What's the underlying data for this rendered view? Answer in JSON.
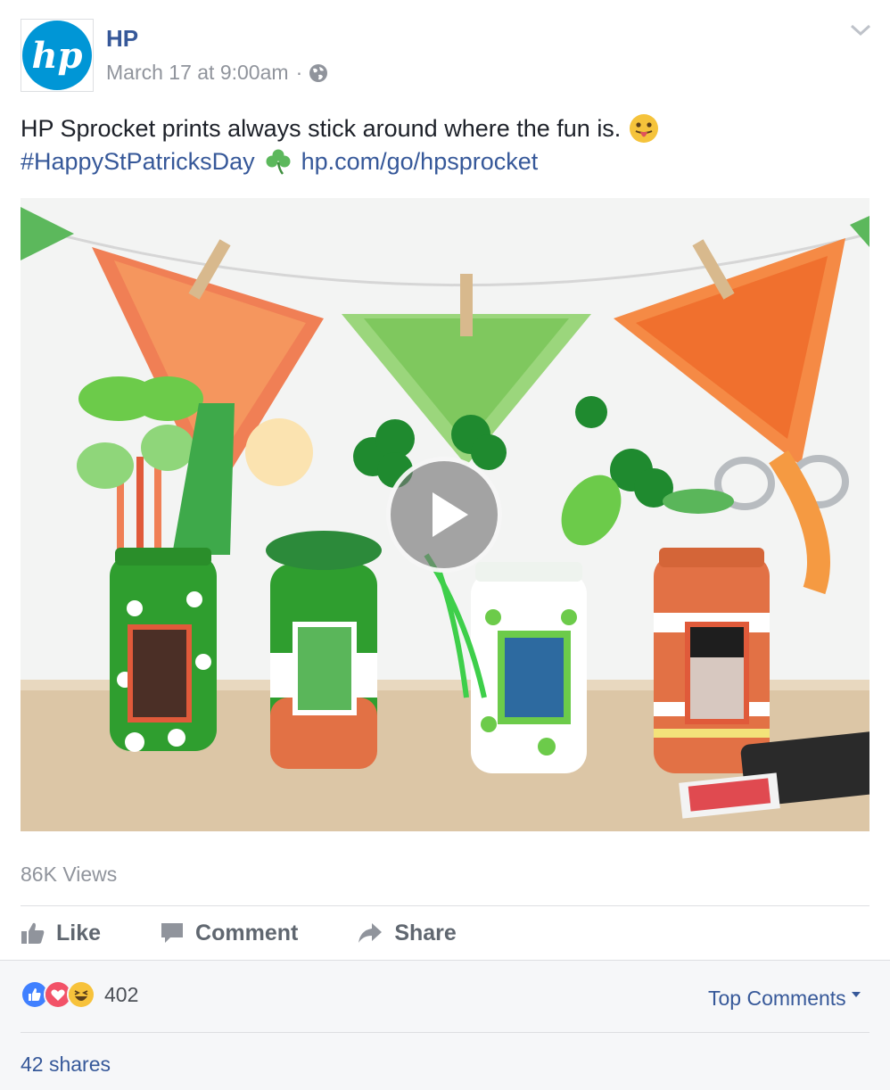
{
  "header": {
    "page_name": "HP",
    "timestamp": "March 17 at 9:00am",
    "separator": "·",
    "logo_text": "hp",
    "audience_icon": "globe-icon",
    "menu_icon": "chevron-down-icon"
  },
  "post": {
    "text": "HP Sprocket prints always stick around where the fun is.",
    "emoji": "tongue-out-face-icon",
    "hashtag": "#HappyStPatricksDay",
    "hashtag_emoji": "shamrock-icon",
    "link": "hp.com/go/hpsprocket"
  },
  "video": {
    "play_icon": "play-icon",
    "views": "86K Views"
  },
  "actions": {
    "like": "Like",
    "comment": "Comment",
    "share": "Share"
  },
  "footer": {
    "reaction_icons": [
      "like-reaction-icon",
      "love-reaction-icon",
      "haha-reaction-icon"
    ],
    "reaction_count": "402",
    "top_comments": "Top Comments",
    "shares": "42 shares"
  },
  "colors": {
    "link_blue": "#365899",
    "hp_blue": "#0096d6",
    "muted_grey": "#90949c",
    "action_grey": "#606770",
    "footer_bg": "#f6f7f9"
  }
}
